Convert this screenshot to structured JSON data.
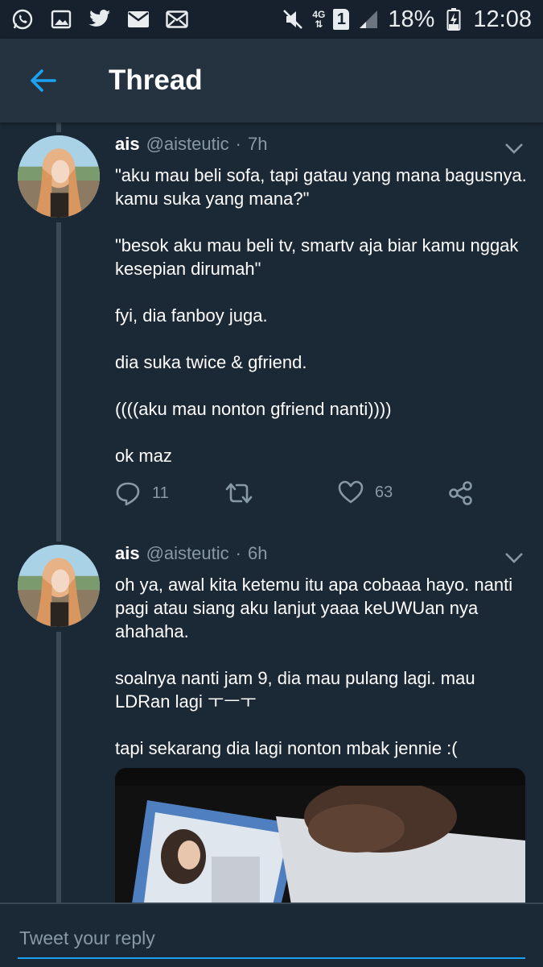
{
  "status_bar": {
    "network": "4G",
    "sim": "1",
    "battery": "18%",
    "time": "12:08"
  },
  "app_bar": {
    "title": "Thread"
  },
  "tweets": [
    {
      "name": "ais",
      "handle": "@aisteutic",
      "separator": "·",
      "time": "7h",
      "paragraphs": [
        "\"aku mau beli sofa, tapi gatau yang mana bagusnya. kamu suka yang mana?\"",
        "\"besok aku mau beli tv, smartv aja biar kamu nggak kesepian dirumah\"",
        "fyi, dia fanboy juga.",
        "dia suka twice & gfriend.",
        "((((aku mau nonton gfriend nanti))))",
        "ok maz"
      ],
      "replies": "11",
      "likes": "63"
    },
    {
      "name": "ais",
      "handle": "@aisteutic",
      "separator": "·",
      "time": "6h",
      "paragraphs": [
        "oh ya, awal kita ketemu itu apa cobaaa hayo. nanti pagi atau siang aku lanjut yaaa keUWUan nya ahahaha.",
        "soalnya nanti jam 9, dia mau pulang lagi. mau LDRan lagi ㅜㅡㅜ",
        "tapi sekarang dia lagi nonton mbak jennie :("
      ]
    }
  ],
  "reply": {
    "placeholder": "Tweet your reply"
  },
  "colors": {
    "background": "#1b2836",
    "app_bar": "#253341",
    "accent": "#1da1f2",
    "secondary_text": "#8899a6"
  }
}
